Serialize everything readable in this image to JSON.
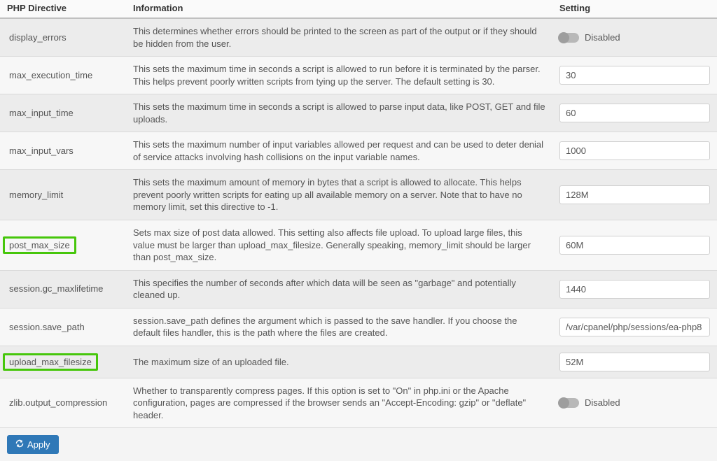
{
  "headers": {
    "directive": "PHP Directive",
    "information": "Information",
    "setting": "Setting"
  },
  "toggle_disabled_label": "Disabled",
  "apply_label": "Apply",
  "rows": [
    {
      "directive": "display_errors",
      "info": "This determines whether errors should be printed to the screen as part of the output or if they should be hidden from the user.",
      "type": "toggle",
      "value": "Disabled",
      "highlight": false
    },
    {
      "directive": "max_execution_time",
      "info": "This sets the maximum time in seconds a script is allowed to run before it is terminated by the parser. This helps prevent poorly written scripts from tying up the server. The default setting is 30.",
      "type": "text",
      "value": "30",
      "highlight": false
    },
    {
      "directive": "max_input_time",
      "info": "This sets the maximum time in seconds a script is allowed to parse input data, like POST, GET and file uploads.",
      "type": "text",
      "value": "60",
      "highlight": false
    },
    {
      "directive": "max_input_vars",
      "info": "This sets the maximum number of input variables allowed per request and can be used to deter denial of service attacks involving hash collisions on the input variable names.",
      "type": "text",
      "value": "1000",
      "highlight": false
    },
    {
      "directive": "memory_limit",
      "info": "This sets the maximum amount of memory in bytes that a script is allowed to allocate. This helps prevent poorly written scripts for eating up all available memory on a server. Note that to have no memory limit, set this directive to -1.",
      "type": "text",
      "value": "128M",
      "highlight": false
    },
    {
      "directive": "post_max_size",
      "info": "Sets max size of post data allowed. This setting also affects file upload. To upload large files, this value must be larger than upload_max_filesize. Generally speaking, memory_limit should be larger than post_max_size.",
      "type": "text",
      "value": "60M",
      "highlight": true
    },
    {
      "directive": "session.gc_maxlifetime",
      "info": "This specifies the number of seconds after which data will be seen as \"garbage\" and potentially cleaned up.",
      "type": "text",
      "value": "1440",
      "highlight": false
    },
    {
      "directive": "session.save_path",
      "info": "session.save_path defines the argument which is passed to the save handler. If you choose the default files handler, this is the path where the files are created.",
      "type": "text",
      "value": "/var/cpanel/php/sessions/ea-php8",
      "highlight": false
    },
    {
      "directive": "upload_max_filesize",
      "info": "The maximum size of an uploaded file.",
      "type": "text",
      "value": "52M",
      "highlight": true
    },
    {
      "directive": "zlib.output_compression",
      "info": "Whether to transparently compress pages. If this option is set to \"On\" in php.ini or the Apache configuration, pages are compressed if the browser sends an \"Accept-Encoding: gzip\" or \"deflate\" header.",
      "type": "toggle",
      "value": "Disabled",
      "highlight": false
    }
  ]
}
